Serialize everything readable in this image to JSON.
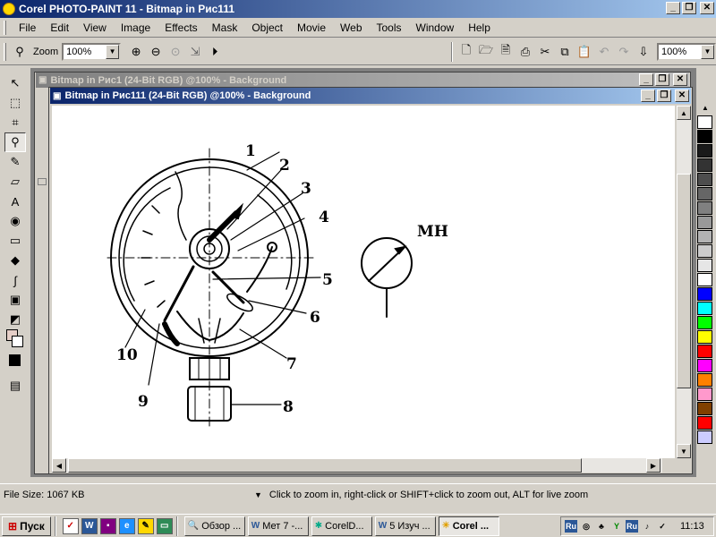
{
  "app": {
    "title": "Corel PHOTO-PAINT 11 - Bitmap in Рис111",
    "win_min": "_",
    "win_restore": "❐",
    "win_close": "✕"
  },
  "menu": [
    "File",
    "Edit",
    "View",
    "Image",
    "Effects",
    "Mask",
    "Object",
    "Movie",
    "Web",
    "Tools",
    "Window",
    "Help"
  ],
  "toolbar": {
    "zoom_label": "Zoom",
    "zoom_value": "100%",
    "right_zoom_value": "100%"
  },
  "documents": [
    {
      "title": "Bitmap in Рис1 (24-Bit RGB) @100% - Background"
    },
    {
      "title": "Bitmap in Рис111 (24-Bit RGB) @100% - Background"
    }
  ],
  "figure": {
    "labels": [
      "1",
      "2",
      "3",
      "4",
      "5",
      "6",
      "7",
      "8",
      "9",
      "10"
    ],
    "symbol_label": "МН"
  },
  "palette": [
    "#ffffff",
    "#000000",
    "#1a1a1a",
    "#333333",
    "#4d4d4d",
    "#666666",
    "#808080",
    "#999999",
    "#b3b3b3",
    "#cccccc",
    "#e6e6e6",
    "#ffffff",
    "#0000ff",
    "#00ffff",
    "#00ff00",
    "#ffff00",
    "#ff0000",
    "#ff00ff",
    "#ff8000",
    "#ff99cc",
    "#804000",
    "#ff0000",
    "#ccccff"
  ],
  "status": {
    "file_size": "File Size: 1067 KB",
    "hint": "Click to zoom in, right-click or SHIFT+click to zoom out, ALT for live zoom"
  },
  "taskbar": {
    "start": "Пуск",
    "tasks": [
      "Обзор ...",
      "Мет 7 -...",
      "CorelD...",
      "5 Изуч ...",
      "Corel ..."
    ],
    "tray_lang1": "Ru",
    "tray_lang2": "Ru",
    "clock": "11:13"
  }
}
